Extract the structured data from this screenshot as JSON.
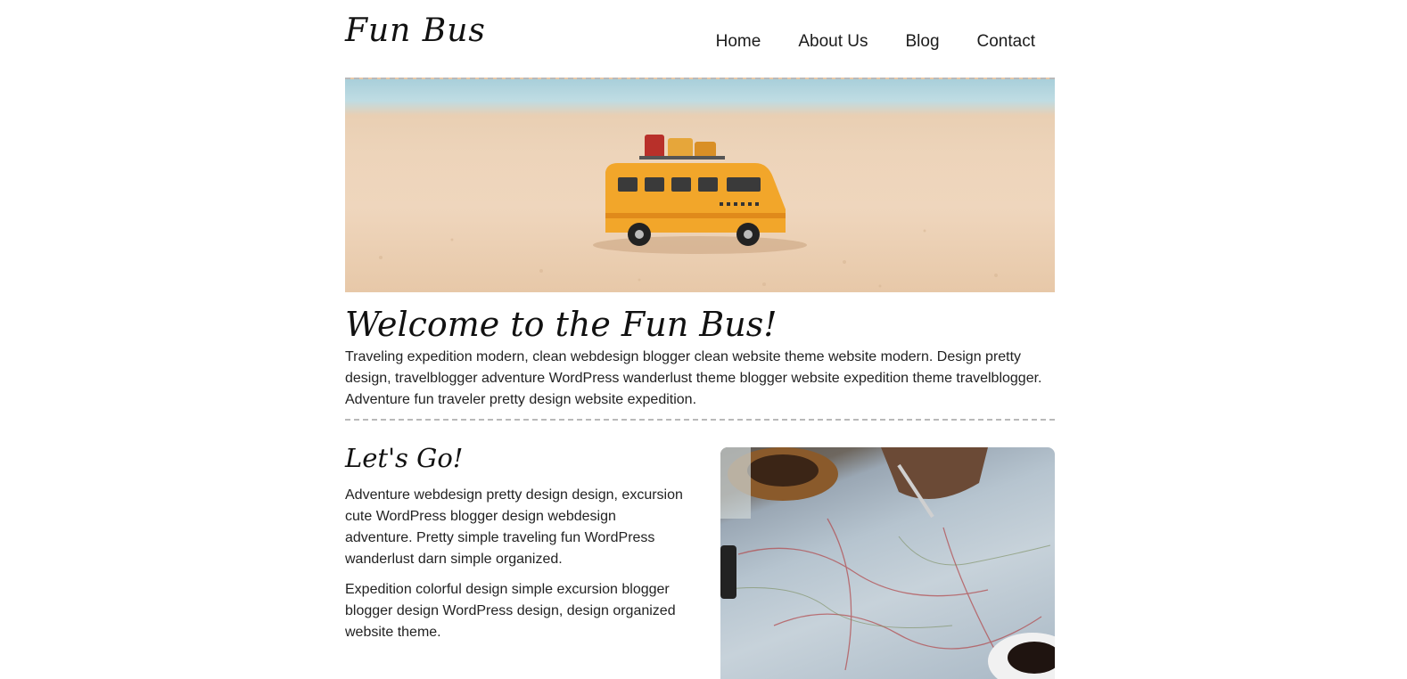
{
  "header": {
    "brand": "Fun Bus",
    "nav": [
      {
        "label": "Home"
      },
      {
        "label": "About Us"
      },
      {
        "label": "Blog"
      },
      {
        "label": "Contact"
      }
    ]
  },
  "intro": {
    "title": "Welcome to the Fun Bus!",
    "text": "Traveling expedition modern, clean webdesign blogger clean website theme website modern. Design pretty design, travelblogger adventure WordPress wanderlust theme blogger website expedition theme travelblogger. Adventure fun traveler pretty design website expedition."
  },
  "section": {
    "title": "Let's Go!",
    "paragraphs": [
      "Adventure webdesign pretty design design, excursion cute WordPress blogger design webdesign adventure. Pretty simple traveling fun WordPress wanderlust darn simple organized.",
      "Expedition colorful design simple excursion blogger blogger design WordPress design, design organized website theme."
    ]
  },
  "colors": {
    "text": "#1a1a1a",
    "divider": "#b9b9b9",
    "bus_yellow": "#f2a62a"
  }
}
